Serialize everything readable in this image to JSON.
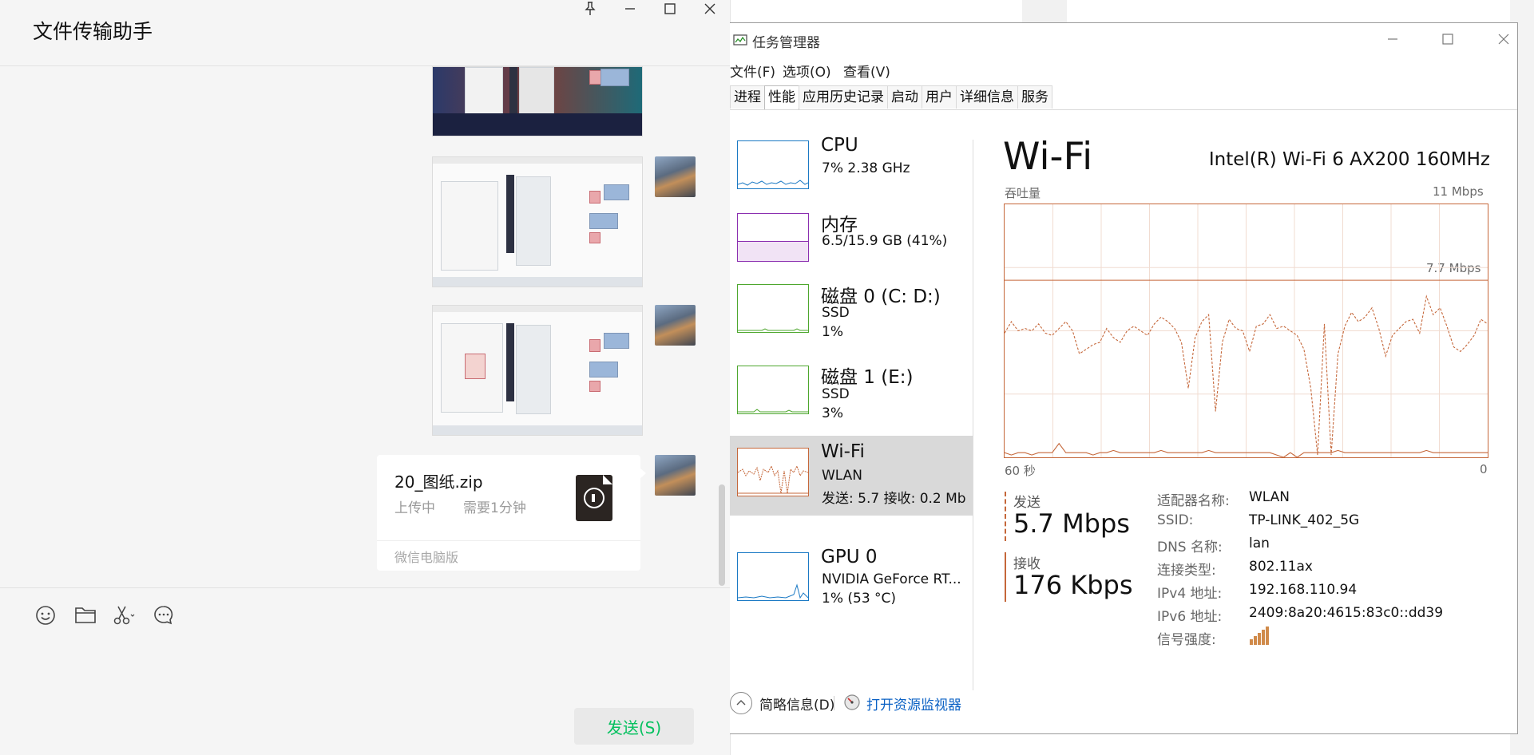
{
  "wechat": {
    "title": "文件传输助手",
    "file": {
      "name": "20_图纸.zip",
      "status": "上传中",
      "eta": "需要1分钟",
      "source": "微信电脑版"
    },
    "send_label": "发送(S)",
    "tool_icons": [
      "emoji-icon",
      "folder-icon",
      "scissors-icon",
      "chat-history-icon"
    ]
  },
  "taskmgr": {
    "title": "任务管理器",
    "menu": [
      "文件(F)",
      "选项(O)",
      "查看(V)"
    ],
    "tabs": [
      "进程",
      "性能",
      "应用历史记录",
      "启动",
      "用户",
      "详细信息",
      "服务"
    ],
    "active_tab": "性能",
    "sidebar": [
      {
        "name": "CPU",
        "sub1": "7%  2.38 GHz",
        "sub2": "",
        "color": "#1a79c4"
      },
      {
        "name": "内存",
        "sub1": "6.5/15.9 GB (41%)",
        "sub2": "",
        "color": "#8b2fb0"
      },
      {
        "name": "磁盘 0 (C: D:)",
        "sub1": "SSD",
        "sub2": "1%",
        "color": "#4ea72e"
      },
      {
        "name": "磁盘 1 (E:)",
        "sub1": "SSD",
        "sub2": "3%",
        "color": "#4ea72e"
      },
      {
        "name": "Wi-Fi",
        "sub1": "WLAN",
        "sub2": "发送: 5.7  接收: 0.2 Mb",
        "color": "#c5673a"
      },
      {
        "name": "GPU 0",
        "sub1": "NVIDIA GeForce RT...",
        "sub2": "1% (53 °C)",
        "color": "#1a79c4"
      }
    ],
    "selected_index": 4,
    "detail": {
      "title": "Wi-Fi",
      "adapter": "Intel(R) Wi-Fi 6 AX200 160MHz",
      "throughput_label": "吞吐量",
      "max_label": "11 Mbps",
      "mid_label": "7.7 Mbps",
      "time_label": "60 秒",
      "zero_label": "0",
      "send_label": "发送",
      "send_value": "5.7 Mbps",
      "recv_label": "接收",
      "recv_value": "176 Kbps",
      "info": [
        {
          "k": "适配器名称:",
          "v": "WLAN"
        },
        {
          "k": "SSID:",
          "v": "TP-LINK_402_5G"
        },
        {
          "k": "DNS 名称:",
          "v": "lan"
        },
        {
          "k": "连接类型:",
          "v": "802.11ax"
        },
        {
          "k": "IPv4 地址:",
          "v": "192.168.110.94"
        },
        {
          "k": "IPv6 地址:",
          "v": "2409:8a20:4615:83c0::dd39"
        },
        {
          "k": "信号强度:",
          "v": ""
        }
      ]
    },
    "footer": {
      "brief": "简略信息(D)",
      "monitor": "打开资源监视器"
    }
  },
  "chart_data": {
    "type": "line",
    "title": "吞吐量",
    "ylim": [
      0,
      11
    ],
    "series": [
      {
        "name": "发送",
        "values": [
          5.4,
          5.9,
          5.5,
          5.6,
          5.5,
          5.8,
          5.4,
          5.3,
          5.6,
          5.9,
          5.5,
          4.5,
          4.7,
          4.9,
          5.0,
          5.6,
          5.2,
          5.0,
          5.5,
          5.7,
          5.5,
          5.3,
          5.8,
          6.1,
          5.9,
          5.6,
          5.0,
          3.0,
          5.2,
          5.9,
          6.2,
          2.0,
          5.0,
          6.0,
          5.6,
          5.5,
          4.6,
          5.7,
          5.8,
          6.2,
          5.6,
          5.7,
          5.5,
          5.3,
          4.7,
          3.0,
          0.1,
          5.8,
          0.1,
          4.5,
          5.7,
          6.3,
          5.9,
          6.1,
          6.5,
          5.6,
          4.4,
          5.3,
          5.6,
          5.9,
          6.0,
          5.4,
          7.0,
          6.2,
          6.5,
          5.7,
          4.8,
          4.6,
          4.9,
          5.3,
          6.0,
          5.8
        ]
      },
      {
        "name": "接收",
        "values": [
          0.2,
          0.1,
          0.2,
          0.2,
          0.1,
          0.2,
          0.2,
          0.2,
          0.6,
          0.2,
          0.2,
          0.2,
          0.2,
          0.1,
          0.2,
          0.2,
          0.3,
          0.2,
          0.2,
          0.2,
          0.2,
          0.2,
          0.2,
          0.3,
          0.2,
          0.2,
          0.2,
          0.2,
          0.2,
          0.2,
          0.3,
          0.2,
          0.2,
          0.2,
          0.2,
          0.2,
          0.2,
          0.2,
          0.2,
          0.2,
          0.1,
          0.0,
          0.2,
          0.0,
          0.2,
          0.2,
          0.2,
          0.2,
          0.2,
          0.3,
          0.2,
          0.2,
          0.2,
          0.2,
          0.2,
          0.2,
          0.2,
          0.2,
          0.2,
          0.2,
          0.2,
          0.2,
          0.3,
          0.2,
          0.2,
          0.2,
          0.2,
          0.2,
          0.2,
          0.2,
          0.2,
          0.2
        ]
      }
    ]
  }
}
